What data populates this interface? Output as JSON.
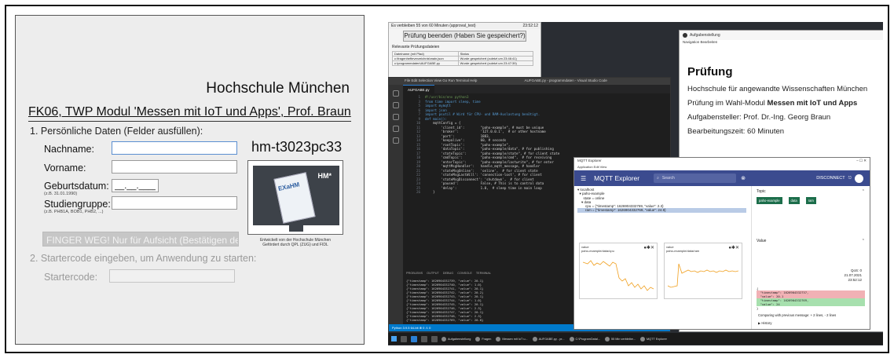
{
  "left_app": {
    "university": "Hochschule München",
    "course": "FK06, TWP Modul 'Messen mit IoT und Apps', Prof. Braun",
    "section1": "1. Persönliche Daten (Felder ausfüllen):",
    "nachname_label": "Nachname:",
    "vorname_label": "Vorname:",
    "geburtsdatum_label": "Geburtsdatum:",
    "geburtsdatum_hint": "(z.B. 31.01.1990)",
    "geburtsdatum_value": "__.__.____",
    "studiengruppe_label": "Studiengruppe:",
    "studiengruppe_hint": "(z.B. PHB1A, BOB1, PHB2, ...)",
    "hostname": "hm-t3023pc33",
    "finger_button": "FINGER WEG!  Nur für Aufsicht (Bestätigen der",
    "section2": "2. Startercode eingeben, um Anwendung zu starten:",
    "startercode_label": "Startercode:",
    "exahm_logo_hm": "HM*",
    "exahm_logo_text": "EXaHM",
    "exahm_caption1": "Entwickelt von der Hochschule München",
    "exahm_caption2": "Gefördert durch QPL (ZUG) und FIDL"
  },
  "timer_window": {
    "status": "Es verbleiben 55 von 60 Minuten (approval_test)",
    "time": "23:52:12",
    "end_button": "Prüfung beenden (Haben Sie gespeichert?)",
    "files_label": "Relevante Prüfungsdateien",
    "col1": "Dateiname (mit Pfad)",
    "col2": "Status",
    "rows": [
      [
        "c:\\fragenhefteverzeichnis\\main.json",
        "Wurde gespeichert (zuletzt um 23:46:41)"
      ],
      [
        "c:\\programmdaten\\AUFGABE.py",
        "Wurde gespeichert (zuletzt um 23:47:39)"
      ]
    ]
  },
  "exam_window": {
    "app_title": "Aufgabenstellung",
    "menu": "Navigation   Bearbeiten",
    "heading": "Prüfung",
    "line1": "Hochschule für angewandte Wissenschaften München",
    "line2_prefix": "Prüfung im Wahl-Modul ",
    "line2_bold": "Messen mit IoT und Apps",
    "line3": "Aufgabensteller: Prof. Dr.-Ing. Georg Braun",
    "line4": "Bearbeitungszeit: 60 Minuten"
  },
  "vscode": {
    "menu": "File  Edit  Selection  View  Go  Run  Terminal  Help",
    "title": "AUFGABE.py - programmdaten - Visual Studio Code",
    "tab": "AUFGABE.py",
    "panel_tabs": "PROBLEMS  OUTPUT  DEBUG CONSOLE  TERMINAL",
    "status": "Python 3.9.5 64-bit  ⊗ 0 ⚠ 0",
    "code": [
      [
        "1",
        "#!/usr/bin/env python3"
      ],
      [
        "3",
        "from time import sleep, time"
      ],
      [
        "5",
        "import mymqtt"
      ],
      [
        "6",
        "import json"
      ],
      [
        "7",
        "import psutil # Wird für CPU- und RAM-Auslastung benötigt."
      ],
      [
        "9",
        "def main():"
      ],
      [
        "10",
        "    mqttConfig = {"
      ],
      [
        "11",
        "        'client_id':        \"paho-example\", # must be unique"
      ],
      [
        "12",
        "        'broker':           '127.0.0.1',  # or other hostname"
      ],
      [
        "13",
        "        'port':             1883,"
      ],
      [
        "14",
        "        'keepalive':        60, # seconds"
      ],
      [
        "15",
        "        'rootTopic':        \"paho-example\","
      ],
      [
        "16",
        "        'dataTopic':        \"paho-example/data\", # for publishing"
      ],
      [
        "17",
        "        'stateTopic':       \"paho-example/state\", # for client state"
      ],
      [
        "18",
        "        'cmdTopic':         \"paho-example/cmd\",  # for receiving"
      ],
      [
        "19",
        "        'enterTopic':       \"paho-example/lastwrite\", # for enter"
      ],
      [
        "20",
        "        'mqttMsgHandler':   handle_mqtt_message, # handler"
      ],
      [
        "21",
        "        'stateMsgOnline':   'online',  # for client state"
      ],
      [
        "22",
        "        'stateMsgLastWill': 'connection-lost', # for client"
      ],
      [
        "23",
        "        'stateMsgDisconnect': 'shutdown',  # for client"
      ],
      [
        "24",
        "        'paused':           False, # This is to control data"
      ],
      [
        "25",
        "        'delay':            1.0,  # sleep time in main loop"
      ],
      [
        "26",
        "    }"
      ]
    ],
    "terminal": [
      "{\"timestamp\": 1626904332739, \"value\": 20.1}",
      "{\"timestamp\": 1626904332740, \"value\": 1.0}",
      "{\"timestamp\": 1626904332741, \"value\": 20.1}",
      "{\"timestamp\": 1626904332742, \"value\": 20.2}",
      "{\"timestamp\": 1626904332743, \"value\": 20.1}",
      "{\"timestamp\": 1626904332744, \"value\": 1.0}",
      "{\"timestamp\": 1626904332745, \"value\": 20.1}",
      "{\"timestamp\": 1626904332746, \"value\": 2.3}",
      "{\"timestamp\": 1626904332747, \"value\": 20.1}",
      "{\"timestamp\": 1626904332748, \"value\": 2.3}",
      "{\"timestamp\": 1626904332769, \"value\": 20.0}"
    ]
  },
  "mqtt": {
    "window_title": "MQTT Explorer",
    "menu": "Application  Edit  View",
    "title": "MQTT Explorer",
    "search_placeholder": "Search",
    "disconnect": "DISCONNECT",
    "tree": [
      "▾ localhost",
      "  ▾ paho-example",
      "      state = online",
      "    ▾ data",
      "        cpu = {\"timestamp\": 1626904332769, \"value\": 2.3}",
      "        ram = {\"timestamp\": 1626904332769, \"value\": 24.9}"
    ],
    "plot1_title": "value",
    "plot1_topic": "paho-example/data/cpu",
    "plot2_title": "value",
    "plot2_topic": "paho-example/data/ram",
    "topic_label": "Topic",
    "chips": [
      "paho-example",
      "data",
      "ram"
    ],
    "value_label": "Value",
    "qos": "QoS: 0",
    "date": "21.07.2021",
    "time": "23:52:12",
    "diff": [
      [
        "",
        "{"
      ],
      [
        "rm",
        "  \"timestamp\": 1626904332737,"
      ],
      [
        "rm",
        "  \"value\": 20.1"
      ],
      [
        "ad",
        "  \"timestamp\": 1626904332769,"
      ],
      [
        "ad",
        "  \"value\": 24"
      ],
      [
        "",
        "}"
      ]
    ],
    "compare": "Comparing with previous message: + 2 lines, - 2 lines",
    "history": "▶ History"
  },
  "taskbar": {
    "items": [
      "Aufgabenstellung",
      "Fragen",
      "Messen mit IoT u...",
      "AUFGABE.py - pr...",
      "C:\\ProgramDatal...",
      "55 Min verbleibe...",
      "MQTT Explorer"
    ]
  }
}
